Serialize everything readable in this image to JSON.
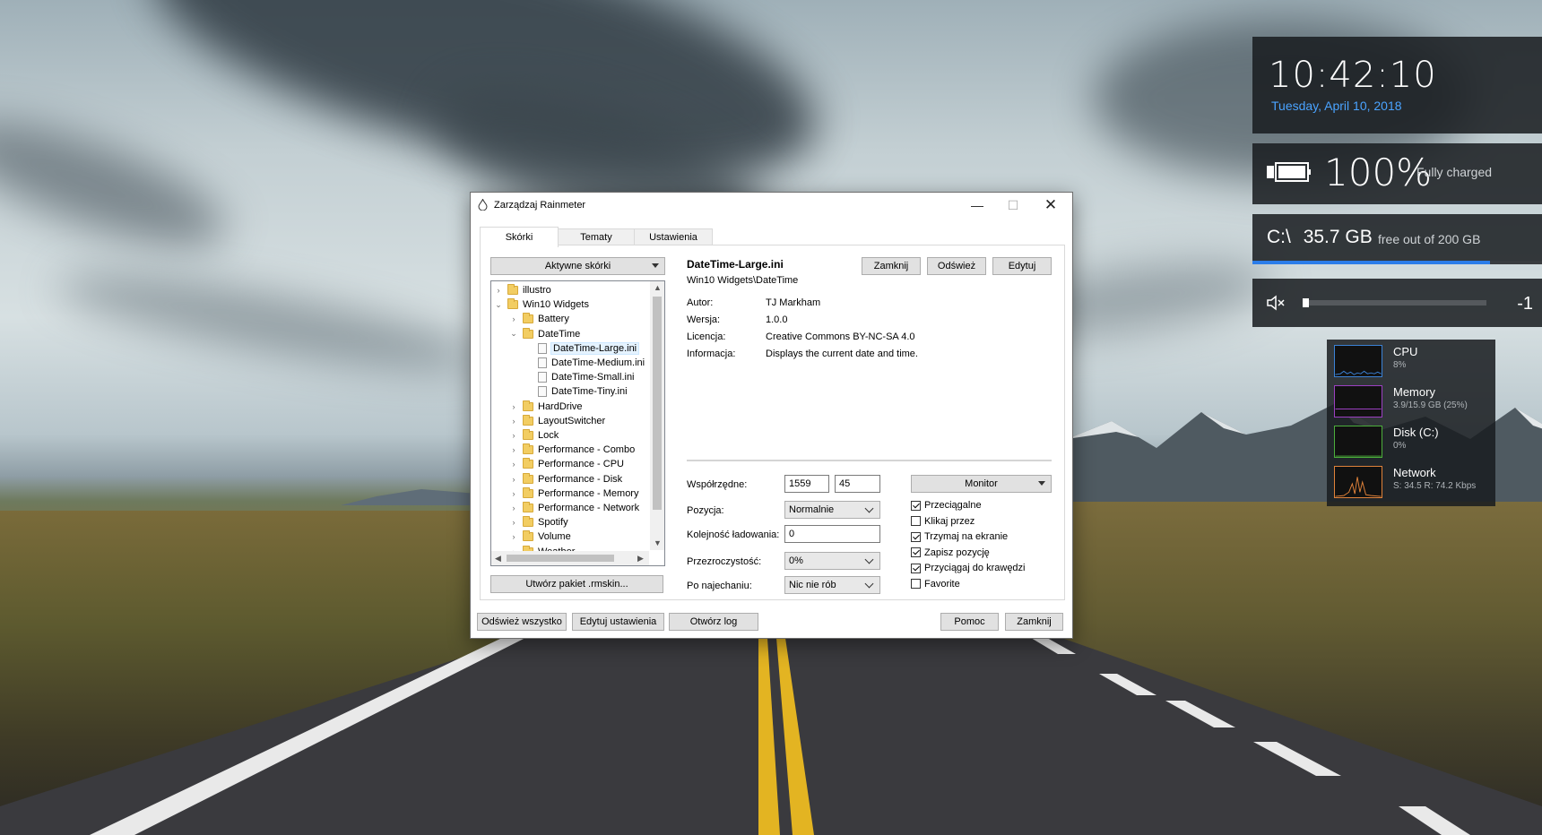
{
  "window": {
    "title": "Zarządzaj Rainmeter",
    "tabs": [
      "Skórki",
      "Tematy",
      "Ustawienia"
    ],
    "active_dropdown": "Aktywne skórki",
    "tree": [
      {
        "label": "illustro",
        "kind": "folder",
        "level": 0,
        "expander": "›"
      },
      {
        "label": "Win10 Widgets",
        "kind": "folder",
        "level": 0,
        "expander": "⌄"
      },
      {
        "label": "Battery",
        "kind": "folder",
        "level": 1,
        "expander": "›"
      },
      {
        "label": "DateTime",
        "kind": "folder",
        "level": 1,
        "expander": "⌄"
      },
      {
        "label": "DateTime-Large.ini",
        "kind": "ini",
        "level": 2,
        "selected": true
      },
      {
        "label": "DateTime-Medium.ini",
        "kind": "ini",
        "level": 2
      },
      {
        "label": "DateTime-Small.ini",
        "kind": "ini",
        "level": 2
      },
      {
        "label": "DateTime-Tiny.ini",
        "kind": "ini",
        "level": 2
      },
      {
        "label": "HardDrive",
        "kind": "folder",
        "level": 1,
        "expander": "›"
      },
      {
        "label": "LayoutSwitcher",
        "kind": "folder",
        "level": 1,
        "expander": "›"
      },
      {
        "label": "Lock",
        "kind": "folder",
        "level": 1,
        "expander": "›"
      },
      {
        "label": "Performance - Combo",
        "kind": "folder",
        "level": 1,
        "expander": "›"
      },
      {
        "label": "Performance - CPU",
        "kind": "folder",
        "level": 1,
        "expander": "›"
      },
      {
        "label": "Performance - Disk",
        "kind": "folder",
        "level": 1,
        "expander": "›"
      },
      {
        "label": "Performance - Memory",
        "kind": "folder",
        "level": 1,
        "expander": "›"
      },
      {
        "label": "Performance - Network",
        "kind": "folder",
        "level": 1,
        "expander": "›"
      },
      {
        "label": "Spotify",
        "kind": "folder",
        "level": 1,
        "expander": "›"
      },
      {
        "label": "Volume",
        "kind": "folder",
        "level": 1,
        "expander": "›"
      },
      {
        "label": "Weather",
        "kind": "folder",
        "level": 1,
        "expander": "›"
      }
    ],
    "create_package": "Utwórz pakiet .rmskin...",
    "skin": {
      "name": "DateTime-Large.ini",
      "path": "Win10 Widgets\\DateTime",
      "buttons": {
        "close": "Zamknij",
        "refresh": "Odśwież",
        "edit": "Edytuj"
      },
      "info": {
        "author_label": "Autor:",
        "author": "TJ Markham",
        "version_label": "Wersja:",
        "version": "1.0.0",
        "license_label": "Licencja:",
        "license": "Creative Commons BY-NC-SA 4.0",
        "info_label": "Informacja:",
        "info": "Displays the current date and time."
      }
    },
    "settings": {
      "coords_label": "Współrzędne:",
      "x": "1559",
      "y": "45",
      "position_label": "Pozycja:",
      "position": "Normalnie",
      "load_order_label": "Kolejność ładowania:",
      "load_order": "0",
      "transparency_label": "Przezroczystość:",
      "transparency": "0%",
      "hover_label": "Po najechaniu:",
      "hover": "Nic nie rób",
      "monitor": "Monitor",
      "checks": [
        {
          "label": "Przeciągalne",
          "checked": true
        },
        {
          "label": "Klikaj przez",
          "checked": false
        },
        {
          "label": "Trzymaj na ekranie",
          "checked": true
        },
        {
          "label": "Zapisz pozycję",
          "checked": true
        },
        {
          "label": "Przyciągaj do krawędzi",
          "checked": true
        },
        {
          "label": "Favorite",
          "checked": false
        }
      ]
    },
    "footer": {
      "refresh_all": "Odśwież wszystko",
      "edit_settings": "Edytuj ustawienia",
      "open_log": "Otwórz log",
      "help": "Pomoc",
      "close": "Zamknij"
    }
  },
  "widgets": {
    "clock": {
      "time": "10:42:10",
      "date": "Tuesday, April 10, 2018",
      "date_color": "#4aa3ff"
    },
    "battery": {
      "percent": "100%",
      "status": "Fully charged",
      "level": 1.0
    },
    "disk": {
      "drive": "C:\\",
      "free": "35.7 GB",
      "subtitle": "free out of 200 GB",
      "used_fraction": 0.82,
      "accent": "#2b7de9"
    },
    "volume": {
      "icon": "mute-icon",
      "level": 0.0,
      "value": "-1"
    },
    "performance": [
      {
        "title": "CPU",
        "value": "8%",
        "color": "#3b82d6"
      },
      {
        "title": "Memory",
        "value": "3.9/15.9 GB (25%)",
        "color": "#9b3fc1"
      },
      {
        "title": "Disk (C:)",
        "value": "0%",
        "color": "#4caf3c"
      },
      {
        "title": "Network",
        "value": "S: 34.5 R: 74.2 Kbps",
        "color": "#e0823a"
      }
    ]
  }
}
